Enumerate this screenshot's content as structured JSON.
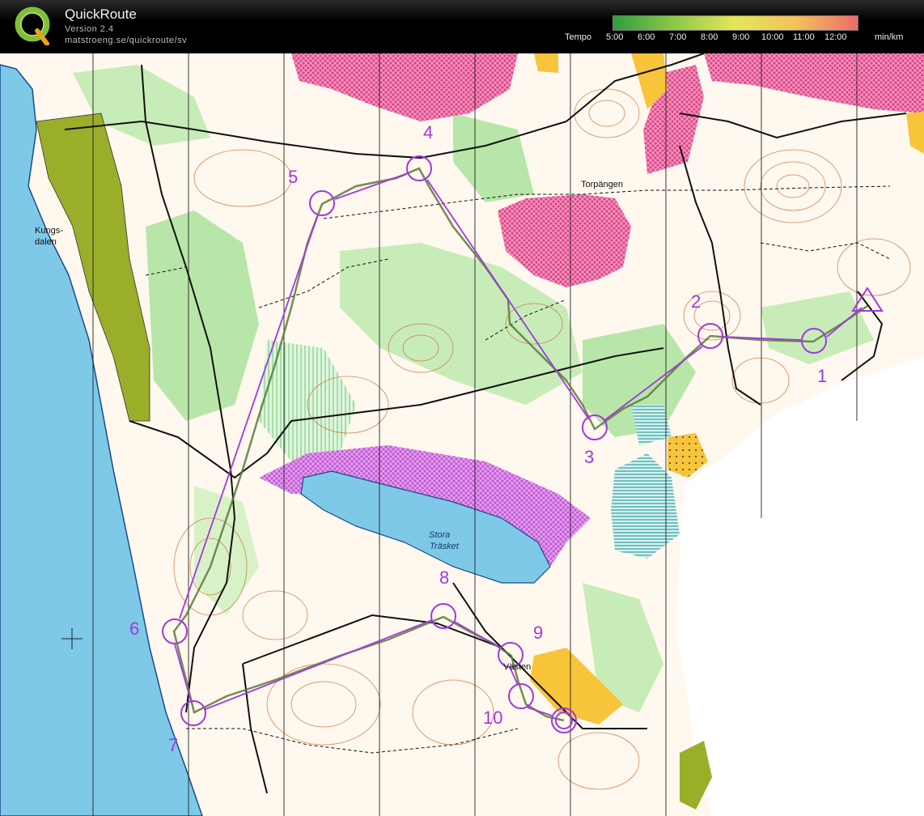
{
  "app": {
    "title": "QuickRoute",
    "version": "Version 2.4",
    "url": "matstroeng.se/quickroute/sv"
  },
  "tempo": {
    "label": "Tempo",
    "ticks": [
      "5:00",
      "6:00",
      "7:00",
      "8:00",
      "9:00",
      "10:00",
      "11:00",
      "12:00"
    ],
    "unit": "min/km",
    "colors": [
      "#2f9e3a",
      "#8cc94b",
      "#e6e65a",
      "#f2c25a",
      "#ee6a6a"
    ]
  },
  "map": {
    "place_names": {
      "kungsdalen_line1": "Kungs-",
      "kungsdalen_line2": "dalen",
      "torpangen": "Torpängen",
      "stora_line1": "Stora",
      "trasket_line2": "Träsket",
      "vasten": "Västen"
    },
    "controls": [
      {
        "number": "1"
      },
      {
        "number": "2"
      },
      {
        "number": "3"
      },
      {
        "number": "4"
      },
      {
        "number": "5"
      },
      {
        "number": "6"
      },
      {
        "number": "7"
      },
      {
        "number": "8"
      },
      {
        "number": "9"
      },
      {
        "number": "10"
      }
    ],
    "colors": {
      "course": "#a238dd",
      "route": "#5a7a3a",
      "water": "#7ec8e8",
      "forest_green": "#b8e6a8",
      "dark_green": "#8cc94b",
      "settlement": "#e0468a",
      "yellow": "#f7c43a",
      "olive": "#9aae2a"
    }
  }
}
